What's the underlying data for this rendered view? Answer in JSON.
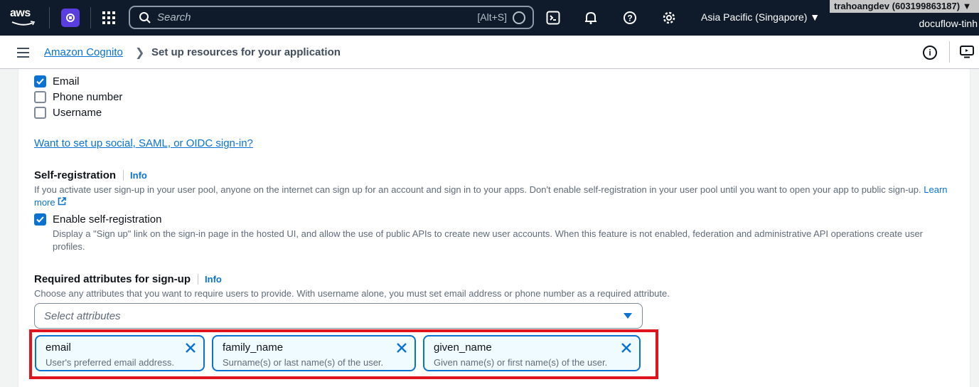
{
  "topbar": {
    "logo_text": "aws",
    "search_placeholder": "Search",
    "search_shortcut": "[Alt+S]",
    "region": "Asia Pacific (Singapore) ▼",
    "account": "trahoangdev (603199863187) ▼",
    "user": "docuflow-tinh"
  },
  "breadcrumb": {
    "parent": "Amazon Cognito",
    "current": "Set up resources for your application"
  },
  "signin_options": [
    {
      "label": "Email",
      "checked": true
    },
    {
      "label": "Phone number",
      "checked": false
    },
    {
      "label": "Username",
      "checked": false
    }
  ],
  "social_link": "Want to set up social, SAML, or OIDC sign-in?",
  "self_registration": {
    "title": "Self-registration",
    "info": "Info",
    "desc": "If you activate user sign-up in your user pool, anyone on the internet can sign up for an account and sign in to your apps. Don't enable self-registration in your user pool until you want to open your app to public sign-up.",
    "learn_more": "Learn more",
    "checkbox_label": "Enable self-registration",
    "checkbox_desc": "Display a \"Sign up\" link on the sign-in page in the hosted UI, and allow the use of public APIs to create new user accounts. When this feature is not enabled, federation and administrative API operations create user profiles."
  },
  "required_attributes": {
    "title": "Required attributes for sign-up",
    "info": "Info",
    "desc": "Choose any attributes that you want to require users to provide. With username alone, you must set email address or phone number as a required attribute.",
    "placeholder": "Select attributes",
    "tokens": [
      {
        "name": "email",
        "desc": "User's preferred email address."
      },
      {
        "name": "family_name",
        "desc": "Surname(s) or last name(s) of the user."
      },
      {
        "name": "given_name",
        "desc": "Given name(s) or first name(s) of the user."
      }
    ]
  },
  "colors": {
    "accent": "#0972d3",
    "topbar": "#0f1b2a",
    "highlight": "#e0141e"
  }
}
